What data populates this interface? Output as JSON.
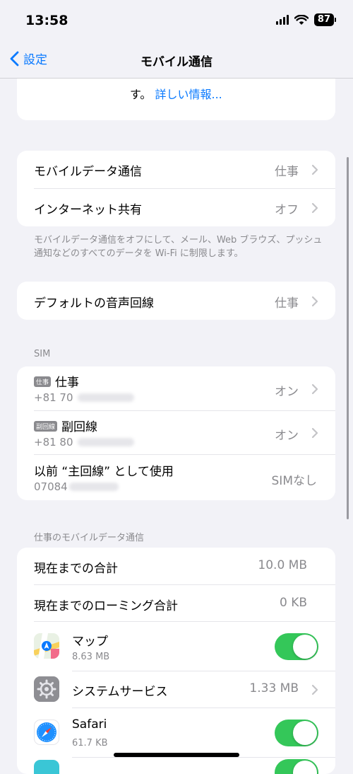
{
  "status_bar": {
    "time": "13:58",
    "battery": "87"
  },
  "nav": {
    "back_label": "設定",
    "title": "モバイル通信"
  },
  "top_note": {
    "text": "す。",
    "link": "詳しい情報..."
  },
  "data_section": {
    "rows": [
      {
        "label": "モバイルデータ通信",
        "value": "仕事"
      },
      {
        "label": "インターネット共有",
        "value": "オフ"
      }
    ],
    "note": "モバイルデータ通信をオフにして、メール、Web ブラウズ、プッシュ通知などのすべてのデータを Wi-Fi に制限します。"
  },
  "voice_line": {
    "label": "デフォルトの音声回線",
    "value": "仕事"
  },
  "sim_section": {
    "header": "SIM",
    "rows": [
      {
        "badge": "仕事",
        "name": "仕事",
        "number": "+81 70",
        "value": "オン"
      },
      {
        "badge": "副回線",
        "name": "副回線",
        "number": "+81 80",
        "value": "オン"
      },
      {
        "name": "以前 “主回線” として使用",
        "number": "07084",
        "value": "SIMなし"
      }
    ]
  },
  "usage_section": {
    "header": "仕事のモバイルデータ通信",
    "current_total": {
      "label": "現在までの合計",
      "value": "10.0 MB"
    },
    "roaming_total": {
      "label": "現在までのローミング合計",
      "value": "0 KB"
    },
    "apps": [
      {
        "name": "マップ",
        "size": "8.63 MB",
        "icon": "maps-icon",
        "enabled": true
      },
      {
        "name": "システムサービス",
        "size": "1.33 MB",
        "icon": "system-services-gear-icon"
      },
      {
        "name": "Safari",
        "size": "61.7 KB",
        "icon": "safari-compass-icon",
        "enabled": true
      }
    ]
  },
  "colors": {
    "accent": "#0a7aff",
    "toggle_on": "#34c759",
    "background": "#f2f2f7"
  }
}
